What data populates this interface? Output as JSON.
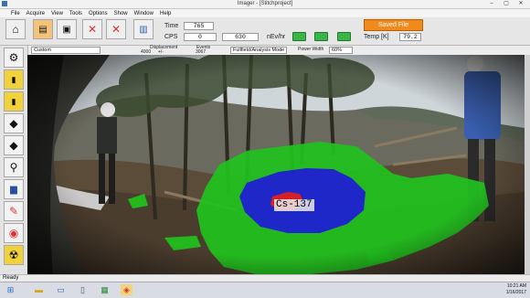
{
  "window": {
    "title": "Imager - [Stitchproject]",
    "controls": [
      "–",
      "▢",
      "✕"
    ]
  },
  "menu": [
    "File",
    "Acquire",
    "View",
    "Tools",
    "Options",
    "Show",
    "Window",
    "Help"
  ],
  "toolbar": {
    "time_label": "Time",
    "time_value": "765",
    "cps_label": "CPS",
    "cps_value_1": "0",
    "cps_value_2": "630",
    "unit_label": "nEv/hr",
    "saved_button": "Saved File",
    "temp_label": "Temp [K]",
    "temp_value": "79.2",
    "status_color": "#39b54a"
  },
  "options": {
    "mode_select": "Custom",
    "displacement_label": "Displacement",
    "displacement_value": "4000",
    "displacement_unit": "+/-",
    "events_label": "Events",
    "events_value": "3067",
    "analysis_select": "Fullfield/Analysis Mode",
    "power_width_label": "Power Width",
    "power_width_value": "60%"
  },
  "viewer": {
    "overlay_label": "Cs-137",
    "colors": {
      "low": "#21c21e",
      "mid": "#1f1fd2",
      "high": "#e02020"
    }
  },
  "statusbar": {
    "text": "Ready"
  },
  "taskbar": {
    "time": "10:21 AM",
    "date": "1/16/2017"
  }
}
